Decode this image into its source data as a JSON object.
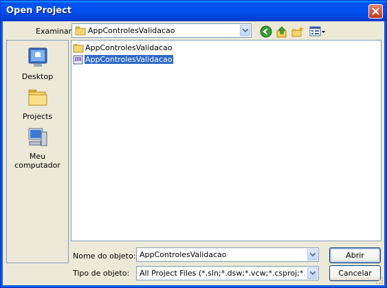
{
  "window": {
    "title": "Open Project"
  },
  "lookin": {
    "label": "Examinar:",
    "value": "AppControlesValidacao"
  },
  "toolbar": {
    "icons": [
      "back-icon",
      "up-folder-icon",
      "new-folder-icon",
      "views-menu-icon"
    ]
  },
  "places": [
    {
      "label": "Desktop",
      "icon": "desktop-icon"
    },
    {
      "label": "Projects",
      "icon": "folder-icon"
    },
    {
      "label": "Meu computador",
      "icon": "my-computer-icon"
    }
  ],
  "files": [
    {
      "name": "AppControlesValidacao",
      "icon": "folder-icon",
      "selected": false
    },
    {
      "name": "AppControlesValidacao",
      "icon": "solution-file-icon",
      "selected": true
    }
  ],
  "filename": {
    "label": "Nome do objeto:",
    "value": "AppControlesValidacao"
  },
  "filetype": {
    "label": "Tipo de objeto:",
    "value": "All Project Files (*.sln;*.dsw;*.vcw;*.csproj;*.fsproj;*.vb"
  },
  "buttons": {
    "open": "Abrir",
    "cancel": "Cancelar"
  }
}
